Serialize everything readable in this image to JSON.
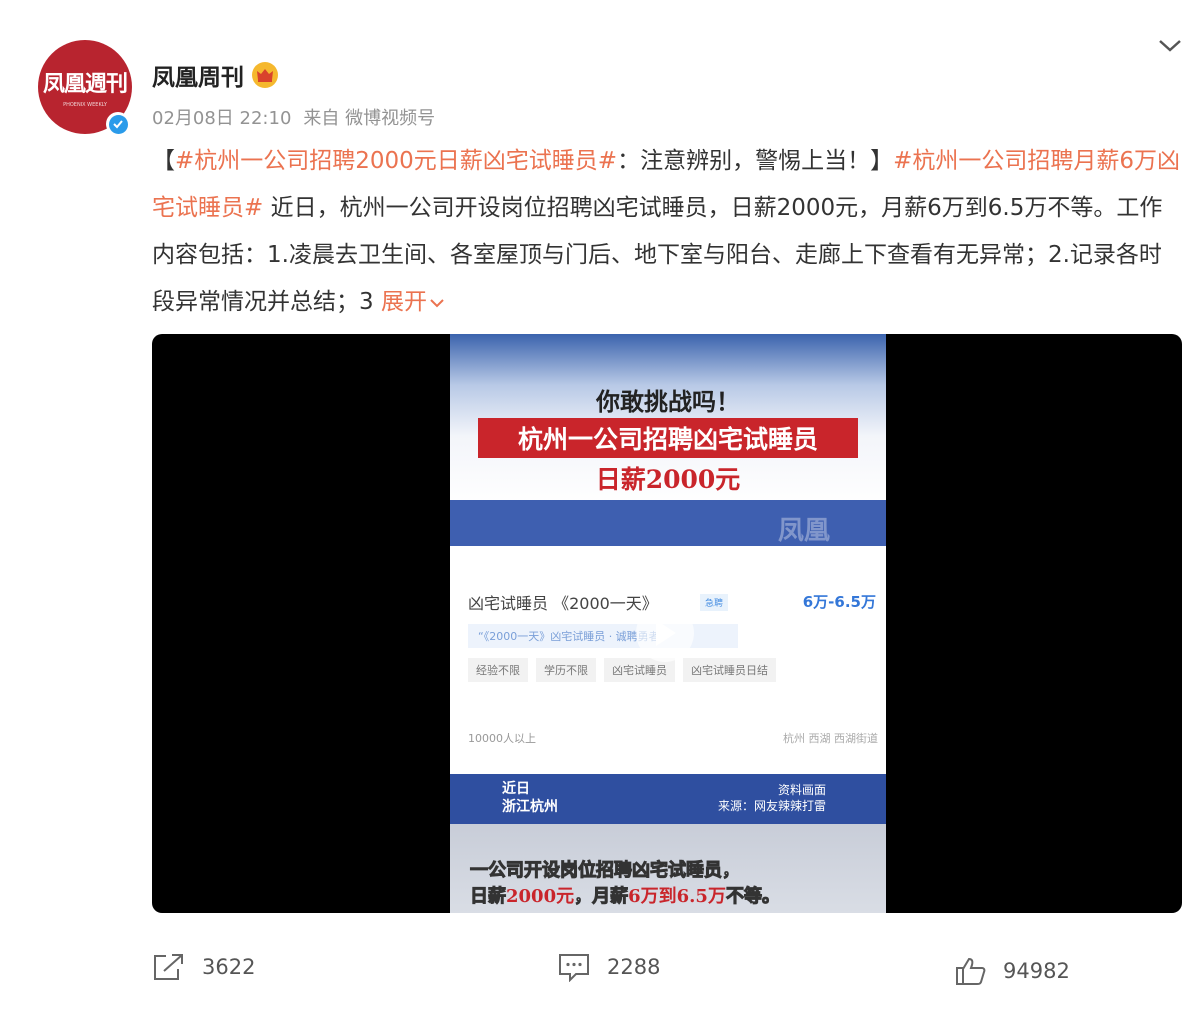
{
  "header": {
    "avatar_text": "凤凰週刊",
    "avatar_sub": "PHOENIX WEEKLY",
    "name": "凤凰周刊",
    "timestamp": "02月08日 22:10",
    "source": "来自 微博视频号"
  },
  "post": {
    "p1": "【",
    "tag1": "#杭州一公司招聘2000元日薪凶宅试睡员#",
    "p2": "：注意辨别，警惕上当！】",
    "tag2": "#杭州一公司招聘月薪6万凶宅试睡员#",
    "p3": " 近日，杭州一公司开设岗位招聘凶宅试睡员，日薪2000元，月薪6万到6.5万不等。工作内容包括：1.凌晨去卫生间、各室屋顶与门后、地下室与阳台、走廊上下查看有无异常；2.记录各时段异常情况并总结；3 ",
    "expand": "展开"
  },
  "video": {
    "title1": "你敢挑战吗！",
    "title2": "杭州一公司招聘凶宅试睡员",
    "title3": "日薪2000元",
    "watermark": "凤凰",
    "job_title": "凶宅试睡员 《2000一天》",
    "job_badge": "急聘",
    "job_salary": "6万-6.5万",
    "job_quote": "“《2000一天》凶宅试睡员 · 诚聘勇者”",
    "chips": [
      "经验不限",
      "学历不限",
      "凶宅试睡员",
      "凶宅试睡员日结"
    ],
    "job_count": "10000人以上",
    "job_location": "杭州 西湖 西湖街道",
    "info_left1": "近日",
    "info_left2": "浙江杭州",
    "info_right1": "资料画面",
    "info_right2": "来源：网友辣辣打雷",
    "sub_line1": "一公司开设岗位招聘凶宅试睡员，",
    "sub_a": "日薪",
    "sub_b": "2000元",
    "sub_c": "，月薪",
    "sub_d": "6万到6.5万",
    "sub_e": "不等。"
  },
  "footer": {
    "share_count": "3622",
    "comment_count": "2288",
    "like_count": "94982"
  },
  "colors": {
    "accent": "#eb7350",
    "avatar_bg": "#b8242f",
    "verified": "#2a9bea",
    "video_blue": "#3e5fb0"
  }
}
